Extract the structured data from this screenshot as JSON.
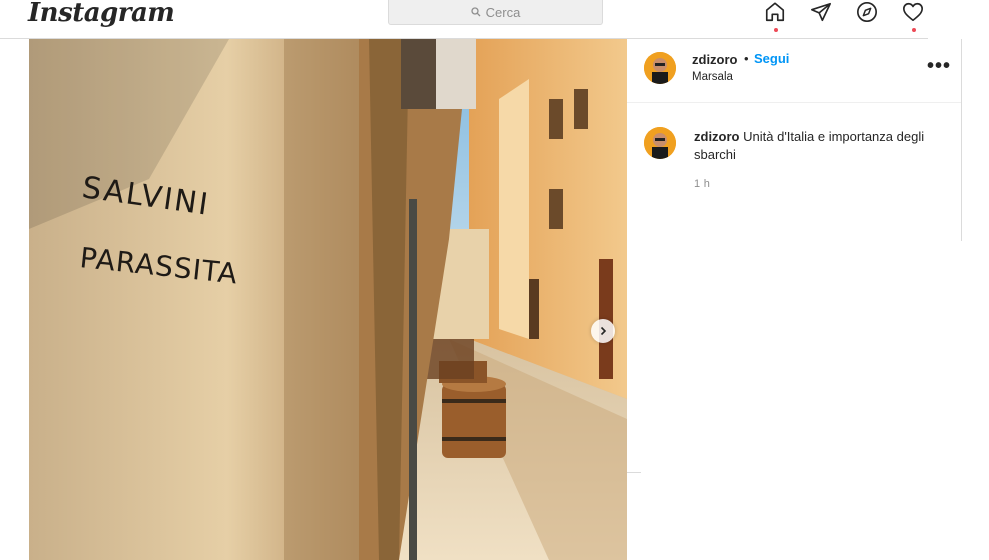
{
  "nav": {
    "logo": "Instagram",
    "search_placeholder": "Cerca",
    "icons": [
      "home-icon",
      "direct-icon",
      "explore-icon",
      "activity-icon"
    ],
    "notification_dot_color": "#ed4956"
  },
  "post": {
    "username": "zdizoro",
    "bullet": "•",
    "follow_label": "Segui",
    "location": "Marsala",
    "more_label": "•••",
    "caption_username": "zdizoro",
    "caption_text": "Unità d'Italia e importanza degli sbarchi",
    "time": "1 h",
    "graffiti_line1": "SALVINI",
    "graffiti_line2": "PARASSITA"
  },
  "colors": {
    "link": "#0095f6",
    "text": "#262626",
    "muted": "#8e8e8e"
  }
}
